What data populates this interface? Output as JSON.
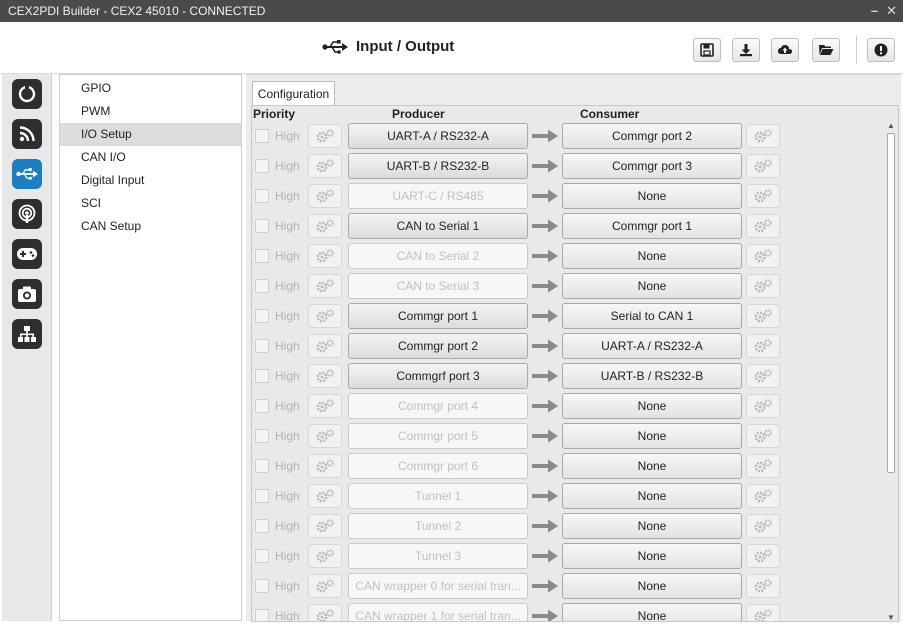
{
  "window": {
    "title": "CEX2PDI Builder - CEX2 45010 - CONNECTED",
    "minimize_glyph": "–",
    "close_glyph": "✕"
  },
  "header": {
    "title": "Input / Output",
    "title_icon": "usb-icon",
    "toolbar_icons": [
      "save-icon",
      "download-icon",
      "cloud-upload-icon",
      "folder-open-icon",
      "info-icon"
    ]
  },
  "iconbar": {
    "items": [
      "power-icon",
      "rss-icon",
      "usb-icon",
      "podcast-icon",
      "gamepad-icon",
      "camera-icon",
      "sitemap-icon"
    ],
    "active": "usb-icon"
  },
  "menu": {
    "items": [
      "GPIO",
      "PWM",
      "I/O Setup",
      "CAN I/O",
      "Digital Input",
      "SCI",
      "CAN Setup"
    ],
    "selected": "I/O Setup"
  },
  "tab": {
    "label": "Configuration"
  },
  "columns": {
    "priority": "Priority",
    "producer": "Producer",
    "consumer": "Consumer"
  },
  "rows": [
    {
      "priority": "High",
      "producer": "UART-A / RS232-A",
      "active": true,
      "consumer": "Commgr port 2"
    },
    {
      "priority": "High",
      "producer": "UART-B / RS232-B",
      "active": true,
      "consumer": "Commgr port 3"
    },
    {
      "priority": "High",
      "producer": "UART-C / RS485",
      "active": false,
      "consumer": "None"
    },
    {
      "priority": "High",
      "producer": "CAN to Serial 1",
      "active": true,
      "consumer": "Commgr port 1"
    },
    {
      "priority": "High",
      "producer": "CAN to Serial 2",
      "active": false,
      "consumer": "None"
    },
    {
      "priority": "High",
      "producer": "CAN to Serial 3",
      "active": false,
      "consumer": "None"
    },
    {
      "priority": "High",
      "producer": "Commgr port 1",
      "active": true,
      "consumer": "Serial to CAN 1"
    },
    {
      "priority": "High",
      "producer": "Commgr port 2",
      "active": true,
      "consumer": "UART-A / RS232-A"
    },
    {
      "priority": "High",
      "producer": "Commgrf port 3",
      "active": true,
      "consumer": "UART-B / RS232-B"
    },
    {
      "priority": "High",
      "producer": "Commgr port 4",
      "active": false,
      "consumer": "None"
    },
    {
      "priority": "High",
      "producer": "Commgr port 5",
      "active": false,
      "consumer": "None"
    },
    {
      "priority": "High",
      "producer": "Commgr port 6",
      "active": false,
      "consumer": "None"
    },
    {
      "priority": "High",
      "producer": "Tunnel 1",
      "active": false,
      "consumer": "None"
    },
    {
      "priority": "High",
      "producer": "Tunnel 2",
      "active": false,
      "consumer": "None"
    },
    {
      "priority": "High",
      "producer": "Tunnel 3",
      "active": false,
      "consumer": "None"
    },
    {
      "priority": "High",
      "producer": "CAN wrapper 0 for serial tran...",
      "active": false,
      "consumer": "None"
    },
    {
      "priority": "High",
      "producer": "CAN wrapper 1 for serial tran...",
      "active": false,
      "consumer": "None"
    }
  ],
  "colors": {
    "accent": "#1d7fc1",
    "titlebar": "#4a4a4a",
    "arrow": "#8a8a8a"
  }
}
